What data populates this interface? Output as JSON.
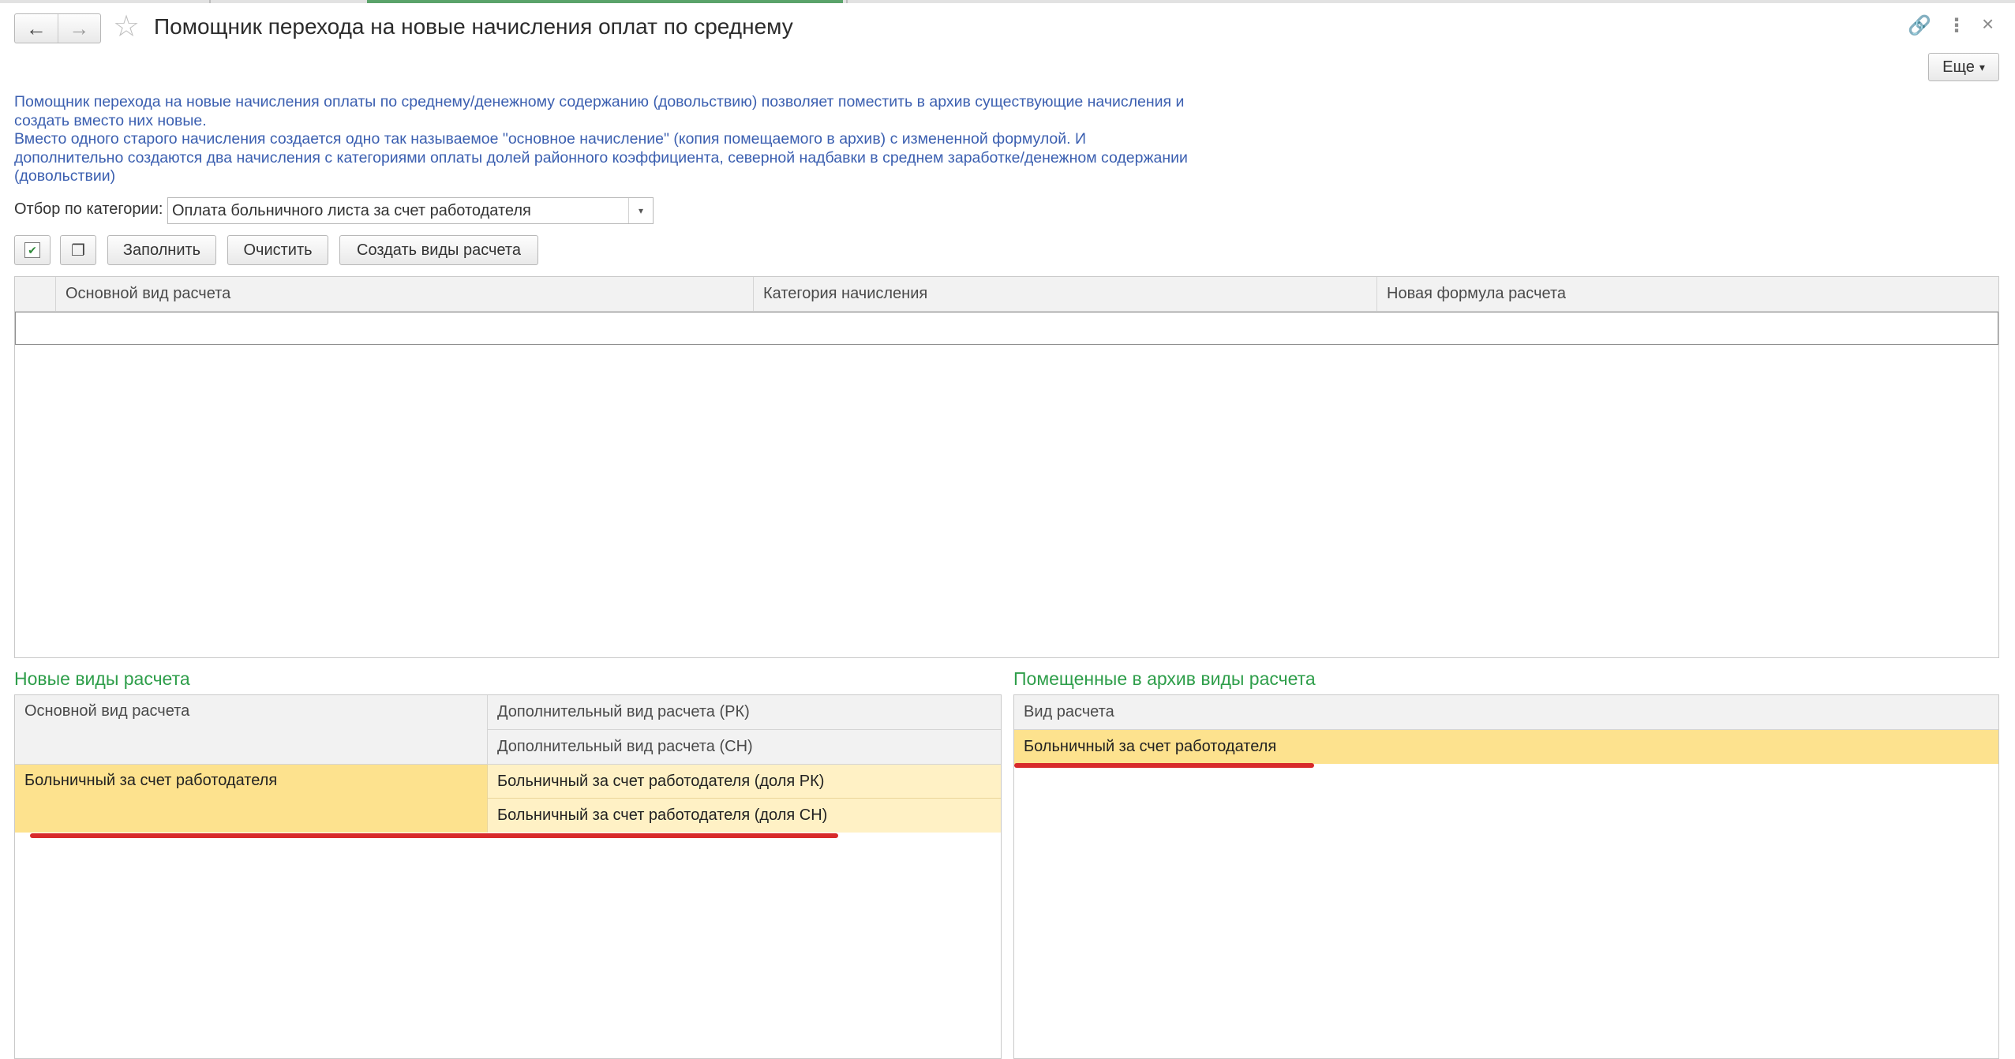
{
  "window": {
    "title": "Помощник перехода на новые начисления оплат по среднему",
    "more_label": "Еще",
    "more_arrow": "▾",
    "back_icon": "←",
    "forward_icon": "→",
    "star_icon": "☆",
    "link_icon": "🔗",
    "menu_icon": "⋮",
    "close_icon": "×"
  },
  "description": {
    "lines": [
      "Помощник перехода на новые начисления оплаты по среднему/денежному содержанию (довольствию) позволяет поместить в архив существующие начисления и",
      "создать вместо них новые.",
      "Вместо одного старого начисления создается одно так называемое \"основное начисление\" (копия помещаемого в архив) с измененной формулой. И",
      "дополнительно создаются два начисления с категориями оплаты долей районного коэффициента, северной надбавки в среднем заработке/денежном содержании",
      "(довольствии)"
    ]
  },
  "filter": {
    "label": "Отбор по категории:",
    "value": "Оплата больничного листа за счет работодателя",
    "dropdown_icon": "▾"
  },
  "toolbar": {
    "check_all_icon": "✔",
    "copy_icon": "❐",
    "fill_label": "Заполнить",
    "clear_label": "Очистить",
    "create_label": "Создать виды расчета"
  },
  "main_table": {
    "columns": [
      "Основной вид расчета",
      "Категория начисления",
      "Новая формула расчета"
    ]
  },
  "new_types": {
    "title": "Новые виды расчета",
    "header_main": "Основной вид расчета",
    "header_rk": "Дополнительный вид расчета (РК)",
    "header_sn": "Дополнительный вид расчета (СН)",
    "rows": [
      {
        "main": "Больничный за счет работодателя",
        "rk": "Больничный за счет работодателя (доля РК)",
        "sn": "Больничный за счет работодателя (доля СН)"
      }
    ]
  },
  "archived_types": {
    "title": "Помещенные в архив виды расчета",
    "header": "Вид расчета",
    "rows": [
      "Больничный за счет работодателя"
    ]
  },
  "colors": {
    "selected_row": "#fde28e",
    "annotation_line": "#d82a2a",
    "section_title": "#2e9e4a",
    "description_text": "#3b5fb0"
  }
}
